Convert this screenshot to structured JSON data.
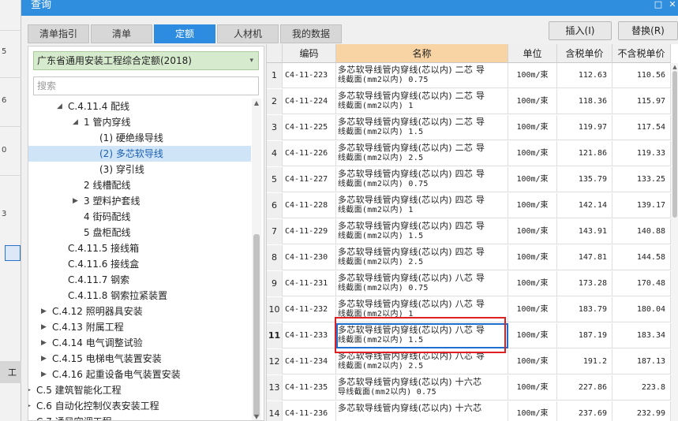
{
  "window": {
    "title": "查询",
    "restore_glyph": "□",
    "close_glyph": "✕"
  },
  "background_app": {
    "marks": [
      "5",
      "6",
      "0",
      "3"
    ],
    "bottom_label": "工"
  },
  "tabs": [
    "清单指引",
    "清单",
    "定额",
    "人材机",
    "我的数据"
  ],
  "active_tab": "定额",
  "actions": {
    "insert": "插入(I)",
    "replace": "替换(R)"
  },
  "quota_library": "广东省通用安装工程综合定额(2018)",
  "search": {
    "placeholder": "搜索"
  },
  "tree": [
    {
      "label": "C.4.11.4 配线",
      "expanded": true
    },
    {
      "label": "1 管内穿线",
      "expanded": true
    },
    {
      "label": "(1) 硬绝缘导线"
    },
    {
      "label": "(2) 多芯软导线",
      "selected": true
    },
    {
      "label": "(3) 穿引线"
    },
    {
      "label": "2 线槽配线"
    },
    {
      "label": "3 塑料护套线",
      "collapsed": true
    },
    {
      "label": "4 街码配线"
    },
    {
      "label": "5 盘柜配线"
    },
    {
      "label": "C.4.11.5 接线箱"
    },
    {
      "label": "C.4.11.6 接线盒"
    },
    {
      "label": "C.4.11.7 钢索"
    },
    {
      "label": "C.4.11.8 钢索拉紧装置"
    },
    {
      "label": "C.4.12 照明器具安装",
      "collapsed": true
    },
    {
      "label": "C.4.13 附属工程",
      "collapsed": true
    },
    {
      "label": "C.4.14 电气调整试验",
      "collapsed": true
    },
    {
      "label": "C.4.15 电梯电气装置安装",
      "collapsed": true
    },
    {
      "label": "C.4.16 起重设备电气装置安装",
      "collapsed": true
    },
    {
      "label": "C.5 建筑智能化工程",
      "collapsed": true
    },
    {
      "label": "C.6 自动化控制仪表安装工程",
      "collapsed": true
    },
    {
      "label": "C.7 通风空调工程",
      "collapsed": true
    }
  ],
  "table": {
    "headers": [
      "编码",
      "名称",
      "单位",
      "含税单价",
      "不含税单价"
    ],
    "rows": [
      {
        "no": "1",
        "code": "C4-11-223",
        "name1": "多芯软导线管内穿线(芯以内) 二芯 导",
        "name2": "线截面(mm2以内) 0.75",
        "unit": "100m/束",
        "price_tax": "112.63",
        "price_notax": "110.56"
      },
      {
        "no": "2",
        "code": "C4-11-224",
        "name1": "多芯软导线管内穿线(芯以内) 二芯 导",
        "name2": "线截面(mm2以内) 1",
        "unit": "100m/束",
        "price_tax": "118.36",
        "price_notax": "115.97"
      },
      {
        "no": "3",
        "code": "C4-11-225",
        "name1": "多芯软导线管内穿线(芯以内) 二芯 导",
        "name2": "线截面(mm2以内) 1.5",
        "unit": "100m/束",
        "price_tax": "119.97",
        "price_notax": "117.54"
      },
      {
        "no": "4",
        "code": "C4-11-226",
        "name1": "多芯软导线管内穿线(芯以内) 二芯 导",
        "name2": "线截面(mm2以内) 2.5",
        "unit": "100m/束",
        "price_tax": "121.86",
        "price_notax": "119.33"
      },
      {
        "no": "5",
        "code": "C4-11-227",
        "name1": "多芯软导线管内穿线(芯以内) 四芯 导",
        "name2": "线截面(mm2以内) 0.75",
        "unit": "100m/束",
        "price_tax": "135.79",
        "price_notax": "133.25"
      },
      {
        "no": "6",
        "code": "C4-11-228",
        "name1": "多芯软导线管内穿线(芯以内) 四芯 导",
        "name2": "线截面(mm2以内) 1",
        "unit": "100m/束",
        "price_tax": "142.14",
        "price_notax": "139.17"
      },
      {
        "no": "7",
        "code": "C4-11-229",
        "name1": "多芯软导线管内穿线(芯以内) 四芯 导",
        "name2": "线截面(mm2以内) 1.5",
        "unit": "100m/束",
        "price_tax": "143.91",
        "price_notax": "140.88"
      },
      {
        "no": "8",
        "code": "C4-11-230",
        "name1": "多芯软导线管内穿线(芯以内) 四芯 导",
        "name2": "线截面(mm2以内) 2.5",
        "unit": "100m/束",
        "price_tax": "147.81",
        "price_notax": "144.58"
      },
      {
        "no": "9",
        "code": "C4-11-231",
        "name1": "多芯软导线管内穿线(芯以内) 八芯 导",
        "name2": "线截面(mm2以内) 0.75",
        "unit": "100m/束",
        "price_tax": "173.28",
        "price_notax": "170.48"
      },
      {
        "no": "10",
        "code": "C4-11-232",
        "name1": "多芯软导线管内穿线(芯以内) 八芯 导",
        "name2": "线截面(mm2以内) 1",
        "unit": "100m/束",
        "price_tax": "183.79",
        "price_notax": "180.04"
      },
      {
        "no": "11",
        "code": "C4-11-233",
        "name1": "多芯软导线管内穿线(芯以内) 八芯 导",
        "name2": "线截面(mm2以内) 1.5",
        "unit": "100m/束",
        "price_tax": "187.19",
        "price_notax": "183.34",
        "current": true
      },
      {
        "no": "12",
        "code": "C4-11-234",
        "name1": "多芯软导线管内穿线(芯以内) 八芯 导",
        "name2": "线截面(mm2以内) 2.5",
        "unit": "100m/束",
        "price_tax": "191.2",
        "price_notax": "187.13"
      },
      {
        "no": "13",
        "code": "C4-11-235",
        "name1": "多芯软导线管内穿线(芯以内) 十六芯",
        "name2": "导线截面(mm2以内) 0.75",
        "unit": "100m/束",
        "price_tax": "227.86",
        "price_notax": "223.8"
      },
      {
        "no": "14",
        "code": "C4-11-236",
        "name1": "多芯软导线管内穿线(芯以内) 十六芯",
        "name2": "",
        "unit": "100m/束",
        "price_tax": "237.69",
        "price_notax": "232.99"
      }
    ]
  }
}
